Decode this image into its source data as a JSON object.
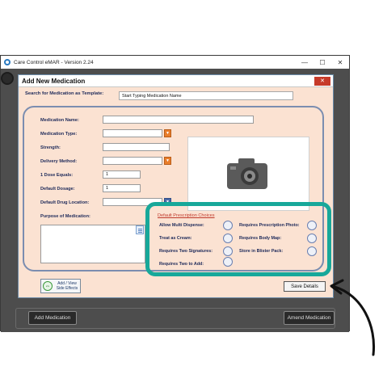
{
  "app": {
    "title": "Care Control eMAR - Version 2.24",
    "window_controls": [
      "—",
      "☐",
      "✕"
    ]
  },
  "background": {
    "add_medication_label": "Add Medication",
    "amend_medication_label": "Amend Medication"
  },
  "dialog": {
    "title": "Add New Medication",
    "close_label": "✕",
    "search": {
      "label": "Search for Medication as Template:",
      "placeholder": "Start Typing Medication Name"
    },
    "fields": {
      "medication_name": {
        "label": "Medication Name:",
        "value": ""
      },
      "medication_type": {
        "label": "Medication Type:",
        "value": ""
      },
      "strength": {
        "label": "Strength:",
        "value": ""
      },
      "delivery_method": {
        "label": "Delivery Method:",
        "value": ""
      },
      "dose_equals": {
        "label": "1 Dose Equals:",
        "value": "1"
      },
      "default_dosage": {
        "label": "Default Dosage:",
        "value": "1"
      },
      "default_drug_location": {
        "label": "Default Drug Location:",
        "value": ""
      },
      "purpose": {
        "label": "Purpose of Medication:",
        "value": ""
      }
    },
    "prescription_choices": {
      "title": "Default Prescription Choices",
      "left": [
        {
          "label": "Allow Multi Dispense:",
          "checked": false
        },
        {
          "label": "Treat as Cream:",
          "checked": false
        },
        {
          "label": "Requires Two Signatures:",
          "checked": false
        },
        {
          "label": "Requires Two to Add:",
          "checked": false
        }
      ],
      "right": [
        {
          "label": "Requires Prescription Photo:",
          "checked": false
        },
        {
          "label": "Requires Body Map:",
          "checked": false
        },
        {
          "label": "Store in Blister Pack:",
          "checked": false
        }
      ]
    },
    "side_effects_label": "Add / View\nSide Effects",
    "save_label": "Save Details"
  },
  "colors": {
    "dialog_bg": "#fbe2d2",
    "highlight": "#17a89a",
    "dropdown_accent": "#e97d2a"
  }
}
